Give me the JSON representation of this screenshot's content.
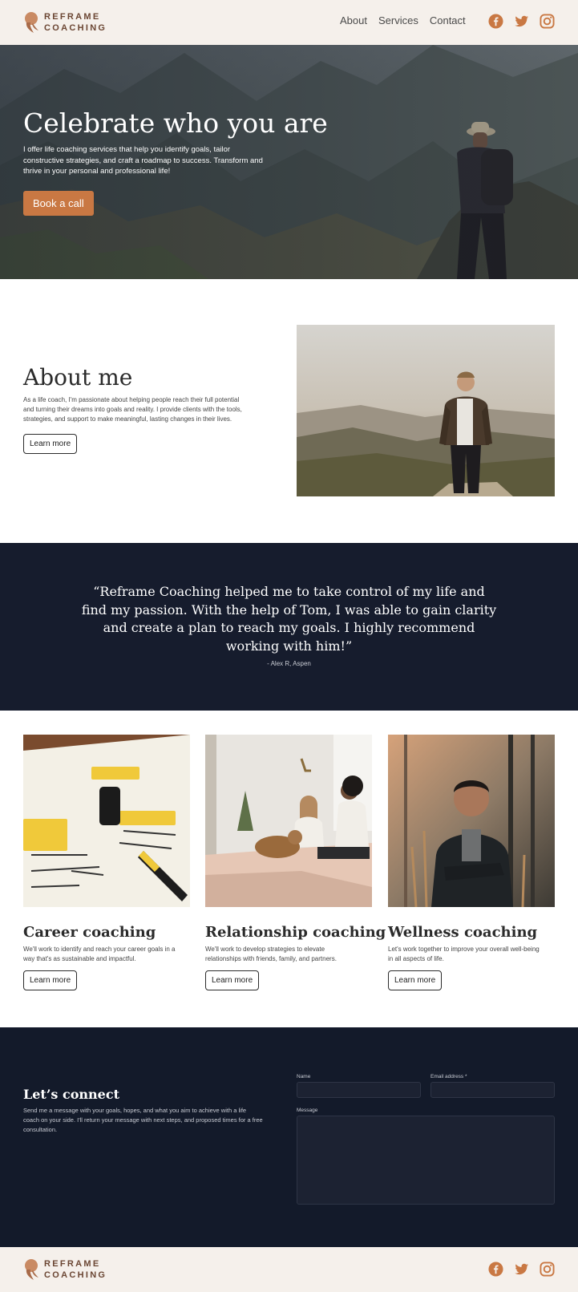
{
  "header": {
    "logo_line1": "REFRAME",
    "logo_line2": "COACHING",
    "nav": [
      {
        "label": "About"
      },
      {
        "label": "Services"
      },
      {
        "label": "Contact"
      }
    ],
    "socials": [
      "facebook-icon",
      "twitter-icon",
      "instagram-icon"
    ]
  },
  "hero": {
    "title": "Celebrate who you are",
    "text": "I offer life coaching services that help you identify goals, tailor constructive strategies, and craft a roadmap to success. Transform and thrive in your personal and professional life!",
    "cta": "Book a call"
  },
  "about": {
    "title": "About me",
    "body": "As a life coach, I'm passionate about helping people reach their full potential and turning their dreams into goals and reality. I provide clients with the tools, strategies, and support to make meaningful, lasting changes in their lives.",
    "cta": "Learn more"
  },
  "testimonial": {
    "quote": "“Reframe Coaching helped me to take control of my life and find my passion. With the help of Tom, I was able to gain clarity and create a plan to reach my goals. I highly recommend working with him!”",
    "author": "- Alex R, Aspen"
  },
  "services": [
    {
      "title": "Career coaching",
      "desc": "We'll work to identify and reach your career goals in a way that's as sustainable and impactful.",
      "cta": "Learn more"
    },
    {
      "title": "Relationship coaching",
      "desc": "We'll work to develop strategies to elevate relationships with friends, family, and partners.",
      "cta": "Learn more"
    },
    {
      "title": "Wellness coaching",
      "desc": "Let's work together to  improve your overall well-being in all aspects of life.",
      "cta": "Learn more"
    }
  ],
  "connect": {
    "title": "Let’s connect",
    "body": "Send me a message with your goals, hopes, and what you aim to achieve with a life coach on your side. I'll return your message with next steps, and proposed times for a free consultation.",
    "name_label": "Name",
    "email_label": "Email address *",
    "message_label": "Message"
  },
  "footer": {
    "logo_line1": "REFRAME",
    "logo_line2": "COACHING"
  },
  "colors": {
    "accent": "#c97843",
    "dark": "#161c2d",
    "cream": "#f5f0eb"
  }
}
